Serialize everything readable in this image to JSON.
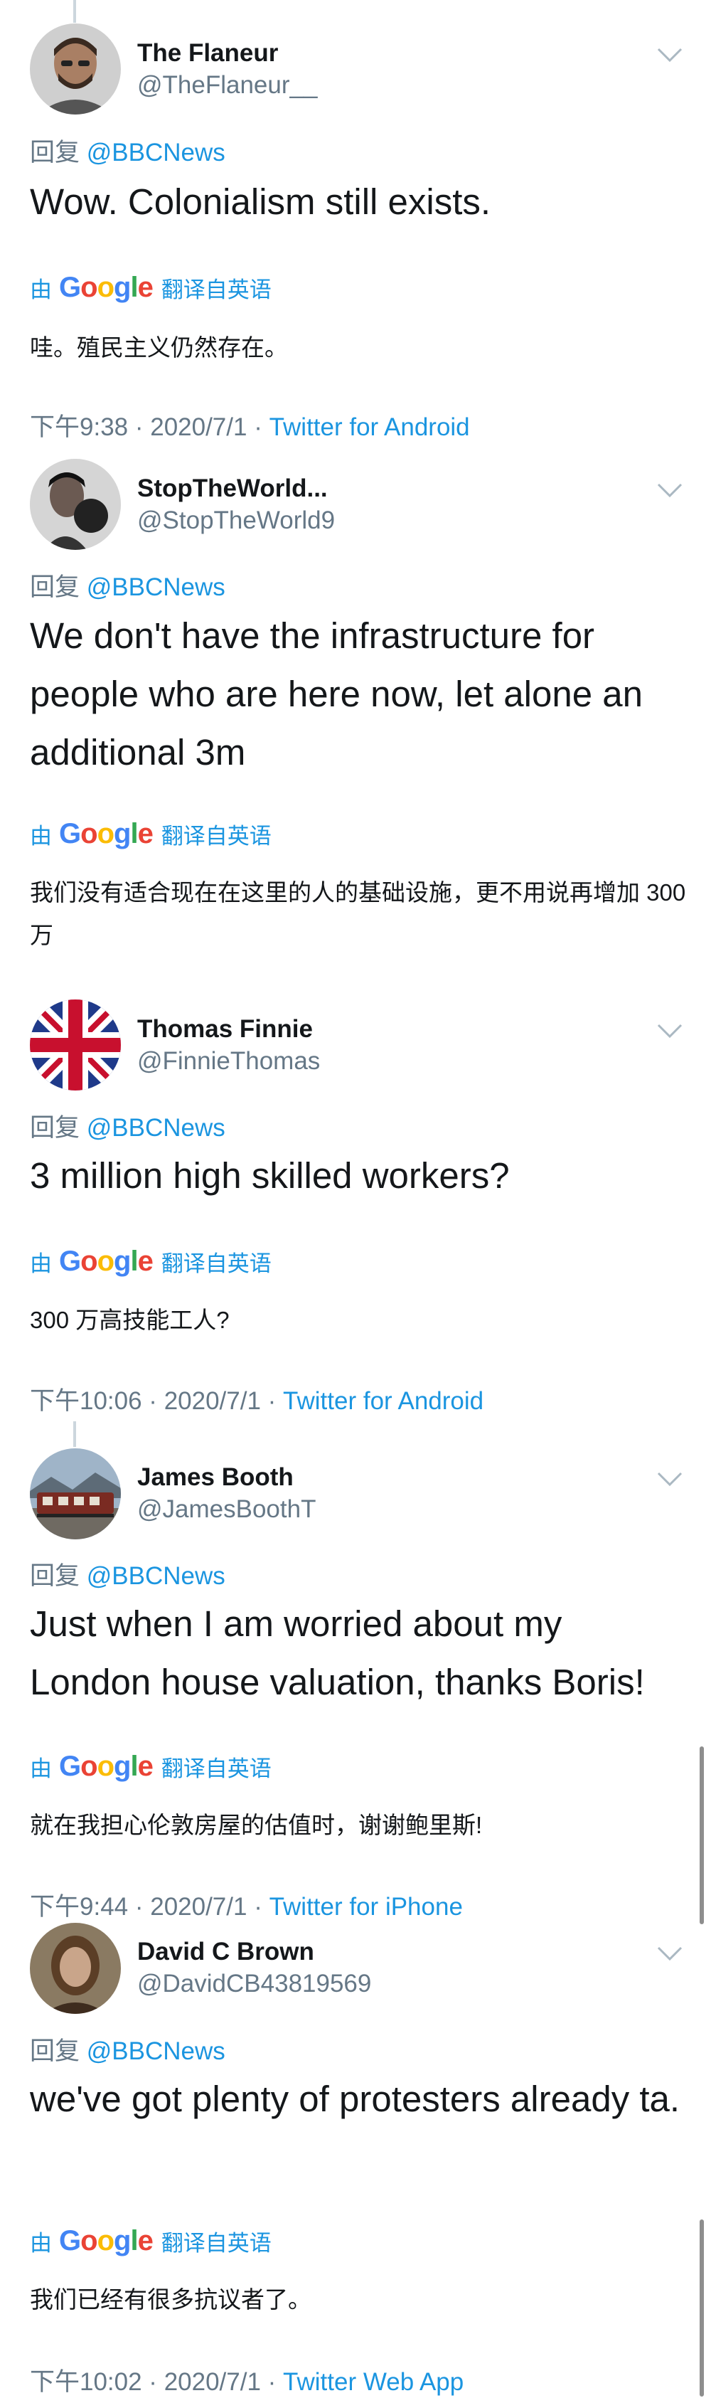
{
  "colors": {
    "link": "#1b95e0",
    "muted": "#657786",
    "text": "#14171a"
  },
  "google_translate": {
    "by": "由",
    "logo": "Google",
    "from": "翻译自英语"
  },
  "tweets": [
    {
      "name": "The Flaneur",
      "handle": "@TheFlaneur__",
      "reply_prefix": "回复",
      "reply_to": "@BBCNews",
      "body": "Wow. Colonialism still exists.",
      "translation": "哇。殖民主义仍然存在。",
      "time": "下午9:38 · 2020/7/1 · ",
      "source": "Twitter for Android",
      "avatar_icon": "man-avatar"
    },
    {
      "name": "StopTheWorld...",
      "handle": "@StopTheWorld9",
      "reply_prefix": "回复",
      "reply_to": "@BBCNews",
      "body": "We don't have the infrastructure for people who are here now, let alone an additional 3m",
      "translation": "我们没有适合现在在这里的人的基础设施，更不用说再增加 300 万",
      "avatar_icon": "boxer-avatar"
    },
    {
      "name": "Thomas Finnie",
      "handle": "@FinnieThomas",
      "reply_prefix": "回复",
      "reply_to": "@BBCNews",
      "body": "3 million high skilled workers?",
      "translation": "300 万高技能工人?",
      "time": "下午10:06 · 2020/7/1 · ",
      "source": "Twitter for Android",
      "avatar_icon": "union-jack-avatar"
    },
    {
      "name": "James Booth",
      "handle": "@JamesBoothT",
      "reply_prefix": "回复",
      "reply_to": "@BBCNews",
      "body": "Just when I am worried about my London house valuation, thanks Boris!",
      "translation": "就在我担心伦敦房屋的估值时，谢谢鲍里斯!",
      "time": "下午9:44 · 2020/7/1 · ",
      "source": "Twitter for iPhone",
      "avatar_icon": "train-avatar"
    },
    {
      "name": "David C Brown",
      "handle": "@DavidCB43819569",
      "reply_prefix": "回复",
      "reply_to": "@BBCNews",
      "body": "we've got plenty of protesters already ta.",
      "translation": "我们已经有很多抗议者了。",
      "time": "下午10:02 · 2020/7/1 · ",
      "source": "Twitter Web App",
      "avatar_icon": "portrait-avatar"
    }
  ]
}
